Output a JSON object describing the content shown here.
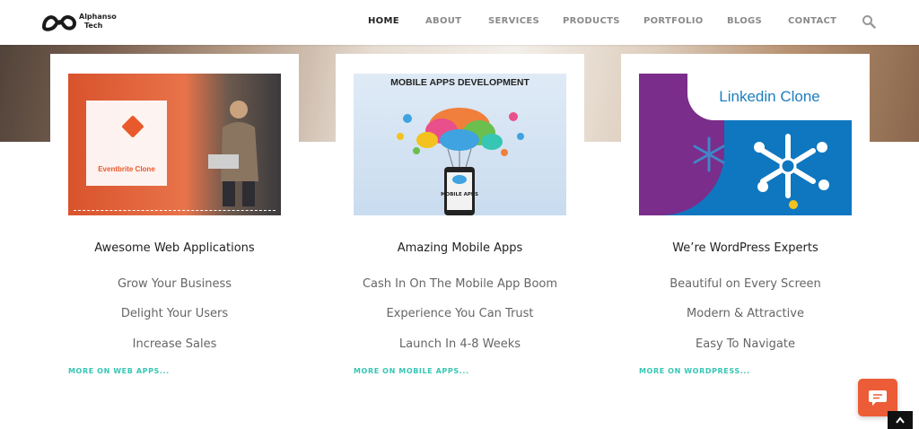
{
  "brand": {
    "name_line1": "Alphanso",
    "name_line2": "Tech"
  },
  "nav": {
    "items": [
      {
        "label": "HOME",
        "active": true
      },
      {
        "label": "ABOUT",
        "active": false
      },
      {
        "label": "SERVICES",
        "active": false
      },
      {
        "label": "PRODUCTS",
        "active": false
      },
      {
        "label": "PORTFOLIO",
        "active": false
      },
      {
        "label": "BLOGS",
        "active": false
      },
      {
        "label": "CONTACT",
        "active": false
      }
    ],
    "search_icon": "search-icon"
  },
  "colors": {
    "accent_link": "#36c6b4",
    "chat_button": "#ec5c37",
    "active_nav": "#222222",
    "nav": "#8a8a8a"
  },
  "cards": [
    {
      "image_text": "Eventbrite Clone",
      "title": "Awesome Web Applications",
      "lines": [
        "Grow Your Business",
        "Delight Your Users",
        "Increase Sales"
      ],
      "link": "MORE ON WEB APPS..."
    },
    {
      "image_text": "MOBILE APPS DEVELOPMENT",
      "image_sub": "MOBILE APPS",
      "title": "Amazing Mobile Apps",
      "lines": [
        "Cash In On The Mobile App Boom",
        "Experience You Can Trust",
        "Launch In 4-8 Weeks"
      ],
      "link": "MORE ON MOBILE APPS..."
    },
    {
      "image_text": "Linkedin Clone",
      "title": "We’re WordPress Experts",
      "lines": [
        "Beautiful on Every Screen",
        "Modern & Attractive",
        "Easy To Navigate"
      ],
      "link": "MORE ON WORDPRESS..."
    }
  ],
  "widgets": {
    "chat_icon": "chat-bubble-icon",
    "scroll_top_icon": "chevron-up-icon"
  }
}
